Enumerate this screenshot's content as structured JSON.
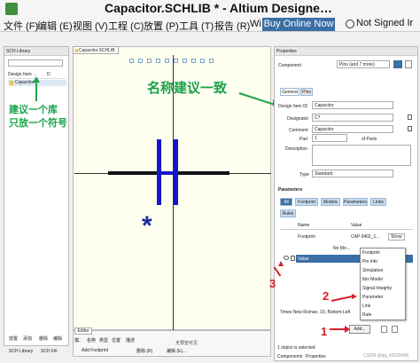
{
  "window": {
    "title": "Capacitor.SCHLIB * - Altium Designe…"
  },
  "menubar": {
    "items": [
      "文件 (F)",
      "编辑 (E)",
      "视图 (V)",
      "工程 (C)",
      "放置 (P)",
      "工具 (T)",
      "报告 (R)",
      "Wi"
    ],
    "buy_online": "Buy Online Now",
    "not_signed_in": "Not Signed Ir"
  },
  "sch_library": {
    "header": "SCH Library",
    "col_design_item": "Design Item …",
    "col_descr": "D",
    "item": "Capacitor",
    "bottom_buttons": [
      "放置",
      "添加",
      "删除",
      "编辑"
    ],
    "bottom_tabs": [
      "SCH Library",
      "SCH Filt"
    ]
  },
  "annotations": {
    "lib_note_line1": "建议一个库",
    "lib_note_line2": "只放一个符号",
    "name_note": "名称建议一致",
    "num1": "1",
    "num2": "2",
    "num3": "3"
  },
  "document": {
    "tab": "Capacitor.SCHLIB",
    "symbol_mark": "*"
  },
  "editor": {
    "tab": "Editor",
    "cols": [
      "模..",
      "名称",
      "类型",
      "位置",
      "描述"
    ],
    "no_data": "无预览可见",
    "add_footprint": "Add Footprint",
    "delete": "删除 (R)",
    "edit": "编辑 (E)..."
  },
  "properties": {
    "header": "Properties",
    "component_label": "Component",
    "pins_filter": "Pins (and 7 more)",
    "tabs": [
      "General",
      "Pins"
    ],
    "design_item_id_label": "Design Item ID",
    "design_item_id_value": "Capacitor",
    "designator_label": "Designator",
    "designator_value": "C?",
    "comment_label": "Comment",
    "comment_value": "Capacitor",
    "part_label": "Part",
    "part_of_parts": "of Parts",
    "part_count": "1",
    "description_label": "Description",
    "type_label": "Type",
    "type_value": "Standard",
    "parameters_header": "Parameters",
    "param_filters": [
      "All",
      "Footprint",
      "Models",
      "Parameters",
      "Links",
      "Rules"
    ],
    "table_name_col": "Name",
    "table_value_col": "Value",
    "row_footprint": "Footprint",
    "row_footprint_value": "CAP 0402_1…",
    "show_label": "Show",
    "no_models": "No Mo…",
    "row_value_label": "Value",
    "font_row": "Times New Roman, 10, Bottom-Left",
    "add_button": "Add...",
    "dropdown_items": [
      "Footprint",
      "Pin Info",
      "Simulation",
      "Ibis Model",
      "Signal Integrity",
      "Parameter",
      "Link",
      "Rule"
    ],
    "status_selected": "1 object is selected",
    "bottom_tabs": [
      "Components",
      "Properties"
    ]
  },
  "watermark": "CSDN @qq_43105490",
  "colors": {
    "accent_blue": "#3b6ea5",
    "annotation_green": "#1aa34a",
    "annotation_red": "#d4202a",
    "symbol_blue": "#1515cc"
  }
}
